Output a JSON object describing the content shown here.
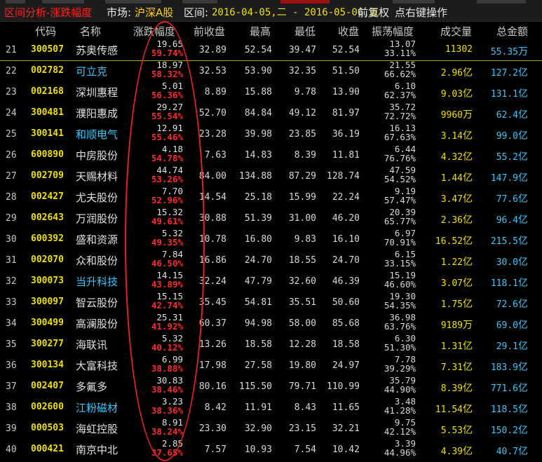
{
  "titlebar": {
    "title": "区间分析-涨跌幅度",
    "market_label": "市场:",
    "market_value": "沪深A股",
    "range_label": "区间:",
    "range_value": "2016-04-05,二 - 2016-05-06,五",
    "adjust": "前复权",
    "hint": "点右键操作"
  },
  "header": {
    "code": "代码",
    "name": "名称",
    "change": "涨跌幅度",
    "prev": "前收盘",
    "high": "最高",
    "low": "最低",
    "close": "收盘",
    "amplitude": "振荡幅度",
    "volume": "成交量",
    "amount": "总金额"
  },
  "rows": [
    {
      "idx": "21",
      "code": "300507",
      "name": "苏奥传感",
      "cyan": false,
      "chg": "19.65",
      "pct": "59.74%",
      "prev": "32.89",
      "high": "52.54",
      "low": "39.47",
      "close": "52.54",
      "amp": "13.07",
      "amp_pct": "33.11%",
      "vol": "11302",
      "vol_unit": "",
      "amt": "55.35",
      "amt_unit": "万"
    },
    {
      "idx": "22",
      "code": "002782",
      "name": "可立克",
      "cyan": true,
      "chg": "18.97",
      "pct": "58.32%",
      "prev": "32.53",
      "high": "53.90",
      "low": "32.35",
      "close": "51.50",
      "amp": "21.55",
      "amp_pct": "66.62%",
      "vol": "2.96",
      "vol_unit": "亿",
      "amt": "127.2",
      "amt_unit": "亿"
    },
    {
      "idx": "23",
      "code": "002168",
      "name": "深圳惠程",
      "cyan": false,
      "chg": "5.01",
      "pct": "56.36%",
      "prev": "8.89",
      "high": "15.88",
      "low": "9.78",
      "close": "13.90",
      "amp": "6.10",
      "amp_pct": "62.37%",
      "vol": "9.03",
      "vol_unit": "亿",
      "amt": "131.1",
      "amt_unit": "亿"
    },
    {
      "idx": "24",
      "code": "300481",
      "name": "濮阳惠成",
      "cyan": false,
      "chg": "29.27",
      "pct": "55.54%",
      "prev": "52.70",
      "high": "84.84",
      "low": "49.12",
      "close": "81.97",
      "amp": "35.72",
      "amp_pct": "72.72%",
      "vol": "9960",
      "vol_unit": "万",
      "amt": "62.4",
      "amt_unit": "亿"
    },
    {
      "idx": "25",
      "code": "300141",
      "name": "和顺电气",
      "cyan": true,
      "chg": "12.91",
      "pct": "55.46%",
      "prev": "23.28",
      "high": "39.98",
      "low": "23.85",
      "close": "36.19",
      "amp": "16.13",
      "amp_pct": "67.63%",
      "vol": "3.14",
      "vol_unit": "亿",
      "amt": "99.0",
      "amt_unit": "亿"
    },
    {
      "idx": "26",
      "code": "600890",
      "name": "中房股份",
      "cyan": false,
      "chg": "4.18",
      "pct": "54.78%",
      "prev": "7.63",
      "high": "14.83",
      "low": "8.39",
      "close": "11.81",
      "amp": "6.44",
      "amp_pct": "76.76%",
      "vol": "4.32",
      "vol_unit": "亿",
      "amt": "55.2",
      "amt_unit": "亿"
    },
    {
      "idx": "27",
      "code": "002709",
      "name": "天赐材料",
      "cyan": false,
      "chg": "44.74",
      "pct": "53.26%",
      "prev": "84.00",
      "high": "134.88",
      "low": "87.29",
      "close": "128.74",
      "amp": "47.59",
      "amp_pct": "54.52%",
      "vol": "1.44",
      "vol_unit": "亿",
      "amt": "147.9",
      "amt_unit": "亿"
    },
    {
      "idx": "28",
      "code": "002427",
      "name": "尤夫股份",
      "cyan": false,
      "chg": "7.70",
      "pct": "52.96%",
      "prev": "14.54",
      "high": "25.18",
      "low": "15.99",
      "close": "22.24",
      "amp": "9.19",
      "amp_pct": "57.47%",
      "vol": "3.47",
      "vol_unit": "亿",
      "amt": "77.6",
      "amt_unit": "亿"
    },
    {
      "idx": "29",
      "code": "002643",
      "name": "万润股份",
      "cyan": false,
      "chg": "15.32",
      "pct": "49.61%",
      "prev": "30.88",
      "high": "51.39",
      "low": "31.00",
      "close": "46.20",
      "amp": "20.39",
      "amp_pct": "65.77%",
      "vol": "2.36",
      "vol_unit": "亿",
      "amt": "96.4",
      "amt_unit": "亿"
    },
    {
      "idx": "30",
      "code": "600392",
      "name": "盛和资源",
      "cyan": false,
      "chg": "5.32",
      "pct": "49.35%",
      "prev": "10.78",
      "high": "16.80",
      "low": "9.83",
      "close": "16.10",
      "amp": "6.97",
      "amp_pct": "70.91%",
      "vol": "16.52",
      "vol_unit": "亿",
      "amt": "215.5",
      "amt_unit": "亿"
    },
    {
      "idx": "31",
      "code": "002070",
      "name": "众和股份",
      "cyan": false,
      "chg": "7.84",
      "pct": "46.50%",
      "prev": "16.86",
      "high": "24.70",
      "low": "18.55",
      "close": "24.70",
      "amp": "6.15",
      "amp_pct": "33.15%",
      "vol": "1.22",
      "vol_unit": "亿",
      "amt": "30.0",
      "amt_unit": "亿"
    },
    {
      "idx": "32",
      "code": "300073",
      "name": "当升科技",
      "cyan": true,
      "chg": "14.15",
      "pct": "43.89%",
      "prev": "32.24",
      "high": "47.79",
      "low": "32.60",
      "close": "46.39",
      "amp": "15.19",
      "amp_pct": "46.60%",
      "vol": "3.07",
      "vol_unit": "亿",
      "amt": "118.1",
      "amt_unit": "亿"
    },
    {
      "idx": "33",
      "code": "300097",
      "name": "智云股份",
      "cyan": false,
      "chg": "15.15",
      "pct": "42.74%",
      "prev": "35.45",
      "high": "54.81",
      "low": "35.51",
      "close": "50.60",
      "amp": "19.30",
      "amp_pct": "54.35%",
      "vol": "1.75",
      "vol_unit": "亿",
      "amt": "72.6",
      "amt_unit": "亿"
    },
    {
      "idx": "34",
      "code": "300499",
      "name": "高澜股份",
      "cyan": false,
      "chg": "25.31",
      "pct": "41.92%",
      "prev": "60.37",
      "high": "94.98",
      "low": "58.00",
      "close": "85.68",
      "amp": "36.98",
      "amp_pct": "63.76%",
      "vol": "9189",
      "vol_unit": "万",
      "amt": "69.0",
      "amt_unit": "亿"
    },
    {
      "idx": "35",
      "code": "300277",
      "name": "海联讯",
      "cyan": false,
      "chg": "5.32",
      "pct": "40.12%",
      "prev": "13.26",
      "high": "18.58",
      "low": "12.28",
      "close": "18.58",
      "amp": "6.30",
      "amp_pct": "51.30%",
      "vol": "1.31",
      "vol_unit": "亿",
      "amt": "29.1",
      "amt_unit": "亿"
    },
    {
      "idx": "36",
      "code": "300134",
      "name": "大富科技",
      "cyan": false,
      "chg": "6.99",
      "pct": "38.88%",
      "prev": "17.98",
      "high": "27.58",
      "low": "19.80",
      "close": "24.97",
      "amp": "7.78",
      "amp_pct": "39.29%",
      "vol": "7.31",
      "vol_unit": "亿",
      "amt": "183.9",
      "amt_unit": "亿"
    },
    {
      "idx": "37",
      "code": "002407",
      "name": "多氟多",
      "cyan": false,
      "chg": "30.83",
      "pct": "38.46%",
      "prev": "80.16",
      "high": "115.50",
      "low": "79.71",
      "close": "110.99",
      "amp": "35.79",
      "amp_pct": "44.90%",
      "vol": "8.39",
      "vol_unit": "亿",
      "amt": "771.6",
      "amt_unit": "亿"
    },
    {
      "idx": "38",
      "code": "002600",
      "name": "江粉磁材",
      "cyan": true,
      "chg": "3.23",
      "pct": "38.36%",
      "prev": "8.42",
      "high": "11.91",
      "low": "8.43",
      "close": "11.65",
      "amp": "3.48",
      "amp_pct": "41.28%",
      "vol": "11.54",
      "vol_unit": "亿",
      "amt": "118.5",
      "amt_unit": "亿"
    },
    {
      "idx": "39",
      "code": "000503",
      "name": "海虹控股",
      "cyan": false,
      "chg": "8.91",
      "pct": "38.24%",
      "prev": "23.30",
      "high": "32.90",
      "low": "23.15",
      "close": "32.21",
      "amp": "9.75",
      "amp_pct": "42.12%",
      "vol": "5.53",
      "vol_unit": "亿",
      "amt": "150.2",
      "amt_unit": "亿"
    },
    {
      "idx": "40",
      "code": "000421",
      "name": "南京中北",
      "cyan": false,
      "chg": "2.85",
      "pct": "37.65%",
      "prev": "7.57",
      "high": "10.93",
      "low": "7.54",
      "close": "10.42",
      "amp": "3.39",
      "amp_pct": "44.96%",
      "vol": "4.39",
      "vol_unit": "亿",
      "amt": "40.7",
      "amt_unit": "亿"
    }
  ],
  "colors": {
    "background": "#000000",
    "code": "#f0e000",
    "cyan_name": "#38c8ff",
    "pct_red": "#ff2828",
    "highlight_ellipse": "#e82020",
    "separator": "#b8a000"
  }
}
